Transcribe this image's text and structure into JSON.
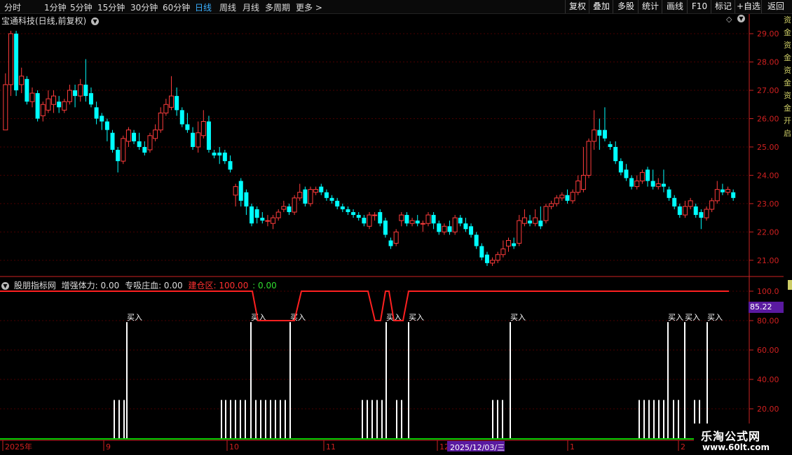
{
  "toolbar": {
    "periods": [
      "分时",
      "1分钟",
      "5分钟",
      "15分钟",
      "30分钟",
      "60分钟",
      "日线",
      "周线",
      "月线",
      "多周期",
      "更多 >"
    ],
    "active_period": "日线",
    "right_buttons": [
      "复权",
      "叠加",
      "多股",
      "统计",
      "画线",
      "F10",
      "标记",
      "+自选",
      "返回"
    ]
  },
  "main_panel": {
    "title": "宝通科技(日线,前复权)",
    "price_axis": [
      "29.00",
      "28.00",
      "27.00",
      "26.00",
      "25.00",
      "24.00",
      "23.00",
      "22.00",
      "21.00"
    ],
    "right_strip_text": "资金资金资金资金开启"
  },
  "indicator_panel": {
    "name": "股朋指标网",
    "label1": "增强体力: 0.00",
    "label2": "专吸庄血: 0.00",
    "label3": "建仓区: 100.00",
    "label4": ": 0.00",
    "axis": [
      "100.0",
      "80.00",
      "60.00",
      "40.00",
      "20.00"
    ],
    "current_value": "85.22",
    "buy_label": "买入"
  },
  "date_axis": {
    "labels": [
      "2025年",
      "9",
      "10",
      "11",
      "12",
      "1",
      "2"
    ],
    "cursor_date": "2025/12/03/三"
  },
  "logo": {
    "name": "乐淘公式网",
    "url": "www.60lt.com"
  },
  "colors": {
    "up": "#ff3c3c",
    "down": "#00ffff",
    "grid": "#4a0000",
    "axis": "#cc2222",
    "line": "#ff2020",
    "bars": "#ffffff",
    "base": "#00cc00"
  },
  "chart_data": [
    {
      "type": "candlestick",
      "title": "宝通科技(日线,前复权)",
      "ylim": [
        20.6,
        29.2
      ],
      "candles": [
        [
          25.6,
          27.2,
          25.6,
          27.6
        ],
        [
          27.2,
          29.0,
          26.8,
          29.1
        ],
        [
          29.0,
          27.0,
          26.8,
          29.1
        ],
        [
          27.2,
          27.5,
          26.9,
          27.8
        ],
        [
          27.4,
          26.6,
          26.5,
          27.5
        ],
        [
          26.6,
          26.9,
          26.4,
          27.1
        ],
        [
          26.9,
          26.0,
          25.9,
          27.0
        ],
        [
          26.1,
          26.5,
          25.9,
          26.6
        ],
        [
          26.3,
          26.7,
          26.2,
          27.0
        ],
        [
          26.5,
          26.8,
          26.2,
          27.0
        ],
        [
          26.6,
          26.4,
          26.2,
          26.8
        ],
        [
          26.3,
          26.6,
          26.2,
          26.7
        ],
        [
          26.6,
          27.0,
          26.5,
          27.2
        ],
        [
          27.0,
          26.8,
          26.4,
          27.2
        ],
        [
          26.8,
          27.2,
          26.6,
          27.4
        ],
        [
          27.2,
          26.8,
          26.6,
          28.1
        ],
        [
          26.9,
          26.5,
          26.4,
          27.1
        ],
        [
          26.4,
          26.0,
          25.8,
          26.6
        ],
        [
          26.1,
          25.9,
          25.6,
          26.2
        ],
        [
          25.9,
          25.6,
          25.2,
          26.0
        ],
        [
          25.5,
          24.9,
          24.8,
          25.6
        ],
        [
          24.9,
          24.5,
          24.1,
          25.0
        ],
        [
          24.5,
          25.3,
          24.4,
          25.4
        ],
        [
          25.2,
          25.6,
          25.0,
          25.7
        ],
        [
          25.5,
          25.2,
          25.1,
          25.6
        ],
        [
          25.2,
          25.0,
          24.9,
          25.5
        ],
        [
          25.0,
          24.8,
          24.7,
          25.2
        ],
        [
          24.9,
          25.4,
          24.8,
          25.5
        ],
        [
          25.3,
          25.6,
          25.2,
          25.8
        ],
        [
          25.6,
          26.2,
          25.5,
          26.4
        ],
        [
          26.2,
          26.5,
          26.1,
          26.7
        ],
        [
          26.4,
          26.8,
          26.3,
          27.5
        ],
        [
          26.8,
          26.3,
          26.1,
          27.1
        ],
        [
          26.3,
          25.8,
          25.7,
          26.4
        ],
        [
          25.8,
          25.6,
          25.5,
          26.2
        ],
        [
          25.5,
          25.0,
          24.9,
          25.7
        ],
        [
          25.0,
          25.5,
          24.8,
          25.9
        ],
        [
          25.4,
          25.9,
          25.3,
          26.3
        ],
        [
          25.9,
          24.9,
          24.8,
          26.1
        ],
        [
          24.8,
          24.7,
          24.6,
          24.9
        ],
        [
          24.8,
          24.7,
          24.4,
          25.0
        ],
        [
          24.8,
          24.5,
          24.4,
          24.9
        ],
        [
          24.5,
          24.2,
          24.1,
          24.7
        ],
        [
          23.3,
          23.6,
          22.9,
          23.7
        ],
        [
          23.8,
          23.1,
          22.9,
          23.9
        ],
        [
          23.4,
          22.9,
          22.6,
          23.5
        ],
        [
          22.9,
          22.3,
          22.2,
          23.0
        ],
        [
          22.8,
          22.5,
          22.3,
          22.9
        ],
        [
          22.5,
          22.4,
          22.3,
          22.7
        ],
        [
          22.4,
          22.4,
          22.2,
          22.6
        ],
        [
          22.3,
          22.5,
          22.1,
          22.6
        ],
        [
          22.5,
          22.7,
          22.4,
          22.8
        ],
        [
          22.8,
          22.9,
          22.7,
          23.1
        ],
        [
          22.9,
          22.7,
          22.6,
          23.0
        ],
        [
          22.7,
          23.2,
          22.6,
          23.3
        ],
        [
          23.2,
          23.4,
          23.1,
          23.7
        ],
        [
          23.5,
          23.0,
          22.9,
          23.6
        ],
        [
          23.0,
          23.5,
          22.9,
          23.6
        ],
        [
          23.4,
          23.5,
          23.3,
          23.6
        ],
        [
          23.6,
          23.4,
          23.3,
          23.7
        ],
        [
          23.4,
          23.2,
          23.1,
          23.5
        ],
        [
          23.2,
          23.1,
          23.0,
          23.3
        ],
        [
          23.1,
          22.9,
          22.8,
          23.2
        ],
        [
          22.9,
          22.8,
          22.7,
          23.0
        ],
        [
          22.8,
          22.7,
          22.6,
          22.9
        ],
        [
          22.7,
          22.6,
          22.5,
          22.8
        ],
        [
          22.6,
          22.5,
          22.4,
          22.7
        ],
        [
          22.5,
          22.3,
          22.2,
          22.6
        ],
        [
          22.2,
          22.6,
          22.1,
          22.7
        ],
        [
          22.6,
          22.6,
          22.4,
          22.7
        ],
        [
          22.7,
          22.3,
          22.2,
          22.8
        ],
        [
          22.4,
          21.9,
          21.8,
          22.5
        ],
        [
          21.7,
          21.5,
          21.4,
          21.8
        ],
        [
          21.6,
          22.0,
          21.5,
          22.1
        ],
        [
          22.4,
          22.6,
          22.2,
          22.7
        ],
        [
          22.6,
          22.3,
          22.2,
          22.7
        ],
        [
          22.3,
          22.4,
          22.2,
          22.5
        ],
        [
          22.4,
          22.3,
          22.2,
          22.6
        ],
        [
          22.3,
          22.3,
          22.0,
          22.4
        ],
        [
          22.3,
          22.6,
          22.2,
          22.7
        ],
        [
          22.6,
          22.3,
          22.1,
          22.7
        ],
        [
          22.3,
          22.0,
          21.9,
          22.4
        ],
        [
          22.0,
          22.2,
          21.9,
          22.3
        ],
        [
          22.2,
          22.0,
          21.9,
          22.4
        ],
        [
          22.0,
          22.5,
          21.9,
          22.6
        ],
        [
          22.5,
          22.3,
          22.2,
          22.6
        ],
        [
          22.3,
          22.1,
          22.0,
          22.5
        ],
        [
          22.2,
          21.9,
          21.8,
          22.3
        ],
        [
          21.9,
          21.5,
          21.4,
          22.0
        ],
        [
          21.5,
          21.1,
          21.0,
          21.6
        ],
        [
          21.2,
          20.9,
          20.8,
          21.3
        ],
        [
          20.9,
          21.0,
          20.8,
          21.1
        ],
        [
          21.0,
          21.2,
          20.9,
          21.3
        ],
        [
          21.2,
          21.4,
          21.1,
          21.7
        ],
        [
          21.5,
          21.7,
          21.3,
          21.8
        ],
        [
          21.6,
          21.5,
          21.4,
          21.8
        ],
        [
          21.6,
          22.4,
          21.5,
          22.6
        ],
        [
          22.3,
          22.5,
          22.2,
          22.8
        ],
        [
          22.4,
          22.3,
          22.2,
          22.6
        ],
        [
          22.3,
          22.5,
          22.2,
          22.8
        ],
        [
          22.4,
          22.2,
          22.1,
          22.9
        ],
        [
          22.4,
          22.9,
          22.3,
          23.0
        ],
        [
          22.9,
          23.0,
          22.8,
          23.1
        ],
        [
          23.0,
          23.2,
          22.9,
          23.3
        ],
        [
          23.2,
          23.3,
          23.1,
          23.4
        ],
        [
          23.3,
          23.1,
          23.0,
          23.5
        ],
        [
          23.1,
          23.4,
          23.0,
          23.5
        ],
        [
          23.4,
          23.8,
          23.3,
          24.0
        ],
        [
          23.5,
          24.0,
          23.4,
          25.0
        ],
        [
          24.0,
          25.2,
          23.9,
          25.3
        ],
        [
          25.2,
          25.6,
          24.9,
          26.3
        ],
        [
          25.6,
          25.4,
          24.9,
          26.0
        ],
        [
          25.6,
          25.3,
          25.2,
          26.4
        ],
        [
          25.1,
          25.0,
          24.9,
          25.2
        ],
        [
          25.0,
          24.5,
          24.4,
          25.2
        ],
        [
          24.5,
          24.1,
          24.0,
          24.6
        ],
        [
          24.2,
          23.9,
          23.8,
          24.4
        ],
        [
          23.9,
          23.6,
          23.5,
          24.0
        ],
        [
          23.6,
          23.8,
          23.5,
          24.0
        ],
        [
          23.8,
          24.1,
          23.7,
          24.2
        ],
        [
          24.2,
          23.8,
          23.6,
          24.3
        ],
        [
          23.8,
          23.6,
          23.5,
          24.2
        ],
        [
          23.6,
          23.7,
          23.5,
          23.9
        ],
        [
          23.7,
          23.6,
          23.4,
          24.2
        ],
        [
          23.5,
          23.2,
          23.1,
          23.6
        ],
        [
          23.2,
          22.9,
          22.8,
          23.3
        ],
        [
          22.9,
          22.6,
          22.5,
          23.0
        ],
        [
          22.6,
          22.9,
          22.5,
          23.1
        ],
        [
          22.9,
          23.1,
          22.8,
          23.2
        ],
        [
          22.9,
          22.6,
          22.5,
          23.0
        ],
        [
          22.7,
          22.5,
          22.1,
          22.8
        ],
        [
          22.5,
          22.8,
          22.4,
          22.9
        ],
        [
          22.8,
          23.1,
          22.7,
          23.2
        ],
        [
          23.1,
          23.5,
          23.0,
          23.8
        ],
        [
          23.5,
          23.4,
          23.3,
          23.7
        ],
        [
          23.4,
          23.5,
          23.3,
          23.6
        ],
        [
          23.4,
          23.2,
          23.1,
          23.5
        ]
      ]
    },
    {
      "type": "bar",
      "title": "股朋指标网",
      "ylim": [
        0,
        100
      ],
      "line": [
        [
          0,
          100
        ],
        [
          360,
          100
        ],
        [
          368,
          80
        ],
        [
          420,
          80
        ],
        [
          430,
          100
        ],
        [
          525,
          100
        ],
        [
          535,
          80
        ],
        [
          543,
          80
        ],
        [
          550,
          100
        ],
        [
          555,
          100
        ],
        [
          562,
          80
        ],
        [
          575,
          80
        ],
        [
          583,
          100
        ],
        [
          1040,
          100
        ]
      ],
      "short_bars": [
        163,
        170,
        177,
        316,
        322,
        329,
        336,
        343,
        350,
        365,
        372,
        379,
        386,
        393,
        400,
        407,
        517,
        524,
        531,
        538,
        545,
        566,
        573,
        703,
        710,
        717,
        912,
        919,
        926,
        933,
        940,
        947,
        961,
        968,
        991,
        998
      ],
      "buy_bars": [
        181,
        358,
        414,
        551,
        583,
        728,
        953,
        977,
        1009
      ]
    }
  ]
}
